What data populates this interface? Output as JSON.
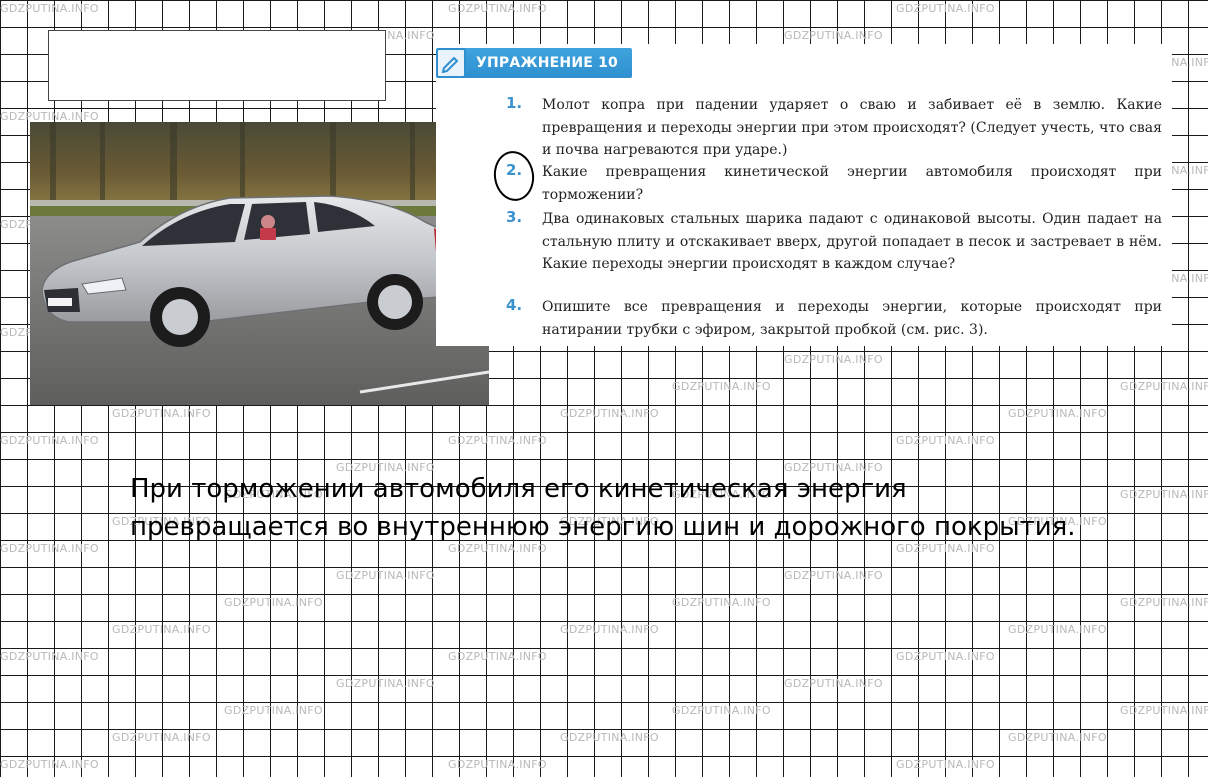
{
  "watermark": "GDZPUTINA.INFO",
  "exercise": {
    "title": "УПРАЖНЕНИЕ 10",
    "icon": "pencil-icon",
    "accent_color": "#2f8fcf",
    "questions": [
      {
        "num": "1.",
        "text": "Молот копра при падении ударяет о сваю и забивает её в землю. Какие превращения и переходы энергии при этом происходят? (Следует учесть, что свая и почва нагреваются при ударе.)"
      },
      {
        "num": "2.",
        "text": "Какие превращения кинетической энергии автомобиля происходят при торможении?"
      },
      {
        "num": "3.",
        "text": "Два одинаковых стальных шарика падают с одинаковой высоты. Один падает на стальную плиту и отскакивает вверх, другой попадает в песок и застревает в нём. Какие переходы энергии происходят в каждом случае?"
      },
      {
        "num": "4.",
        "text": "Опишите все превращения и переходы энергии, которые происходят при натирании трубки с эфиром, закрытой пробкой (см. рис. 3)."
      }
    ]
  },
  "answer": {
    "line1": "При торможении автомобиля его кинетическая энергия",
    "line2": "превращается во внутреннюю энергию шин и дорожного покрытия."
  }
}
